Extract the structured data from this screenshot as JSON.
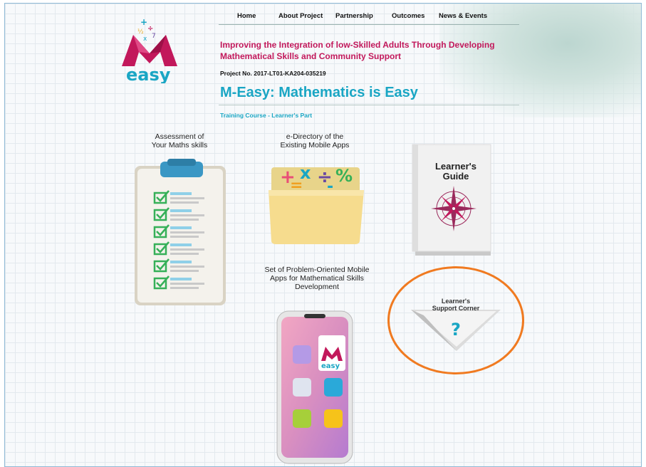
{
  "nav": {
    "items": [
      {
        "label": "Home"
      },
      {
        "label": "About Project"
      },
      {
        "label": "Partnership"
      },
      {
        "label": "Outcomes"
      },
      {
        "label": "News & Events"
      }
    ]
  },
  "logo": {
    "text": "easy"
  },
  "header": {
    "tagline": "Improving the Integration of low-Skilled Adults Through Developing Mathematical Skills and Community Support",
    "project_no": "Project No. 2017-LT01-KA204-035219",
    "title": "M-Easy: Mathematics is Easy",
    "subtitle": "Training Course - Learner's Part"
  },
  "cards": {
    "assessment": {
      "line1": "Assessment of",
      "line2": "Your Maths skills"
    },
    "directory": {
      "line1": "e-Directory of the",
      "line2": "Existing Mobile Apps"
    },
    "guide": {
      "line1": "Learner's",
      "line2": "Guide"
    },
    "apps": {
      "line1": "Set of Problem-Oriented Mobile",
      "line2": "Apps for Mathematical Skills",
      "line3": "Development"
    },
    "support": {
      "line1": "Learner's",
      "line2": "Support Corner",
      "symbol": "?"
    }
  },
  "phone": {
    "logo_text": "easy"
  },
  "colors": {
    "accent": "#1aa6c4",
    "brand": "#c2185b",
    "highlight": "#f07a20"
  }
}
